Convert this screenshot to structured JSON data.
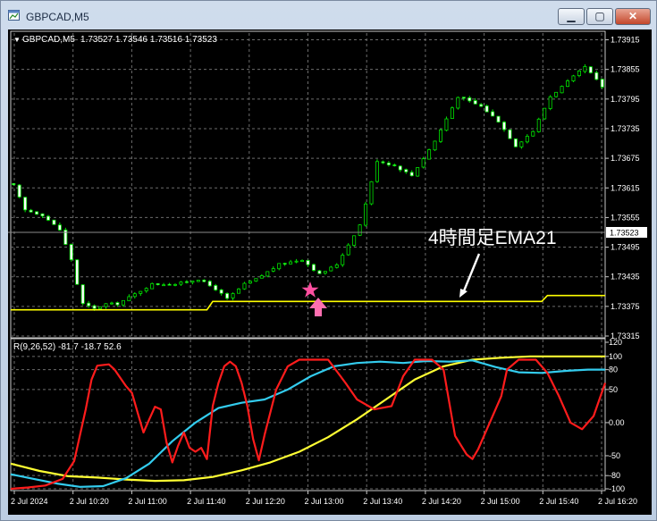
{
  "window": {
    "title": "GBPCAD,M5",
    "minimize_glyph": "▁",
    "maximize_glyph": "▢",
    "close_glyph": "✕",
    "app_icon": "chart-window-icon"
  },
  "main_chart": {
    "header": {
      "arrow": "▼",
      "symbol": "GBPCAD,M5",
      "ohlc": "1.73527 1.73546 1.73516 1.73523"
    },
    "price_labels": [
      "1.73915",
      "1.73855",
      "1.73795",
      "1.73735",
      "1.73675",
      "1.73615",
      "1.73555",
      "1.73495",
      "1.73435",
      "1.73375",
      "1.73315"
    ],
    "current_price": "1.73523",
    "annotation": "4時間足EMA21",
    "arrow_icon": "up-arrow-icon",
    "star_icon": "star-icon"
  },
  "indicator": {
    "header": "R(9,26,52) -81.7 -18.7 52.6",
    "levels": [
      "120",
      "100",
      "80",
      "50",
      "0.00",
      "-50",
      "-80",
      "-100"
    ]
  },
  "time_axis": [
    "2 Jul 2024",
    "2 Jul 10:20",
    "2 Jul 11:00",
    "2 Jul 11:40",
    "2 Jul 12:20",
    "2 Jul 13:00",
    "2 Jul 13:40",
    "2 Jul 14:20",
    "2 Jul 15:00",
    "2 Jul 15:40",
    "2 Jul 16:20"
  ],
  "colors": {
    "bull": "#00e400",
    "bear": "#ffffff",
    "ema": "#ffff00",
    "osc_fast": "#ff1c1c",
    "osc_mid": "#33ccee",
    "osc_slow": "#ffff33",
    "grid": "#6c6c6c",
    "arrow": "#ff6fb0"
  },
  "chart_data": {
    "type": "candlestick",
    "title": "GBPCAD,M5",
    "candle_count": 103,
    "ylim": [
      1.73315,
      1.73925
    ],
    "close_path": [
      [
        0,
        1.7362
      ],
      [
        2,
        1.7357
      ],
      [
        5,
        1.7356
      ],
      [
        8,
        1.7353
      ],
      [
        10,
        1.7347
      ],
      [
        11,
        1.7342
      ],
      [
        12,
        1.7338
      ],
      [
        14,
        1.7337
      ],
      [
        16,
        1.7338
      ],
      [
        18,
        1.7338
      ],
      [
        21,
        1.734
      ],
      [
        24,
        1.7342
      ],
      [
        28,
        1.7342
      ],
      [
        32,
        1.7343
      ],
      [
        35,
        1.7341
      ],
      [
        37,
        1.7339
      ],
      [
        40,
        1.7342
      ],
      [
        42,
        1.7343
      ],
      [
        46,
        1.7346
      ],
      [
        50,
        1.7347
      ],
      [
        53,
        1.7344
      ],
      [
        56,
        1.7346
      ],
      [
        60,
        1.7354
      ],
      [
        63,
        1.7367
      ],
      [
        66,
        1.7366
      ],
      [
        69,
        1.7364
      ],
      [
        73,
        1.7371
      ],
      [
        77,
        1.738
      ],
      [
        81,
        1.7378
      ],
      [
        84,
        1.7375
      ],
      [
        87,
        1.737
      ],
      [
        90,
        1.7373
      ],
      [
        93,
        1.738
      ],
      [
        96,
        1.7383
      ],
      [
        99,
        1.7386
      ],
      [
        102,
        1.7382
      ]
    ],
    "ema21_steps": [
      [
        0,
        1.73368
      ],
      [
        34,
        1.73368
      ],
      [
        35,
        1.73385
      ],
      [
        92,
        1.73385
      ],
      [
        93,
        1.73397
      ],
      [
        103,
        1.73397
      ]
    ],
    "indicator_ylim": [
      -100,
      120
    ],
    "series": [
      {
        "name": "R(9,26,52)",
        "points": [
          [
            0,
            -100
          ],
          [
            3,
            -98
          ],
          [
            6,
            -95
          ],
          [
            9,
            -85
          ],
          [
            11,
            -58
          ],
          [
            13,
            20
          ],
          [
            14,
            65
          ],
          [
            15,
            86
          ],
          [
            17,
            88
          ],
          [
            18,
            80
          ],
          [
            20,
            55
          ],
          [
            21,
            45
          ],
          [
            22,
            15
          ],
          [
            23,
            -15
          ],
          [
            24,
            5
          ],
          [
            25,
            24
          ],
          [
            26,
            20
          ],
          [
            27,
            -30
          ],
          [
            28,
            -60
          ],
          [
            29,
            -35
          ],
          [
            30,
            -15
          ],
          [
            31,
            -38
          ],
          [
            32,
            -44
          ],
          [
            33,
            -38
          ],
          [
            34,
            -55
          ],
          [
            35,
            25
          ],
          [
            36,
            60
          ],
          [
            37,
            85
          ],
          [
            38,
            92
          ],
          [
            39,
            85
          ],
          [
            40,
            60
          ],
          [
            41,
            25
          ],
          [
            42,
            -25
          ],
          [
            43,
            -57
          ],
          [
            44,
            -18
          ],
          [
            46,
            50
          ],
          [
            48,
            85
          ],
          [
            50,
            95
          ],
          [
            55,
            95
          ],
          [
            58,
            60
          ],
          [
            60,
            35
          ],
          [
            63,
            20
          ],
          [
            66,
            25
          ],
          [
            68,
            70
          ],
          [
            70,
            95
          ],
          [
            73,
            95
          ],
          [
            75,
            80
          ],
          [
            77,
            -20
          ],
          [
            79,
            -48
          ],
          [
            80,
            -55
          ],
          [
            81,
            -40
          ],
          [
            83,
            0
          ],
          [
            85,
            40
          ],
          [
            86,
            80
          ],
          [
            88,
            95
          ],
          [
            91,
            95
          ],
          [
            93,
            75
          ],
          [
            95,
            40
          ],
          [
            97,
            0
          ],
          [
            99,
            -10
          ],
          [
            101,
            10
          ],
          [
            103,
            60
          ]
        ]
      },
      {
        "name": "R(9,26,52) mid",
        "points": [
          [
            0,
            -78
          ],
          [
            4,
            -85
          ],
          [
            8,
            -92
          ],
          [
            12,
            -97
          ],
          [
            16,
            -96
          ],
          [
            20,
            -84
          ],
          [
            24,
            -62
          ],
          [
            28,
            -28
          ],
          [
            32,
            0
          ],
          [
            36,
            22
          ],
          [
            40,
            30
          ],
          [
            44,
            35
          ],
          [
            48,
            50
          ],
          [
            52,
            70
          ],
          [
            56,
            85
          ],
          [
            60,
            90
          ],
          [
            64,
            92
          ],
          [
            68,
            90
          ],
          [
            72,
            93
          ],
          [
            76,
            92
          ],
          [
            80,
            94
          ],
          [
            84,
            84
          ],
          [
            88,
            76
          ],
          [
            92,
            75
          ],
          [
            96,
            78
          ],
          [
            100,
            80
          ],
          [
            103,
            80
          ]
        ]
      },
      {
        "name": "R(9,26,52) slow",
        "points": [
          [
            0,
            -62
          ],
          [
            5,
            -73
          ],
          [
            10,
            -81
          ],
          [
            15,
            -83
          ],
          [
            20,
            -86
          ],
          [
            25,
            -88
          ],
          [
            30,
            -87
          ],
          [
            35,
            -82
          ],
          [
            40,
            -72
          ],
          [
            45,
            -60
          ],
          [
            50,
            -44
          ],
          [
            55,
            -22
          ],
          [
            60,
            5
          ],
          [
            65,
            35
          ],
          [
            70,
            65
          ],
          [
            75,
            85
          ],
          [
            80,
            95
          ],
          [
            85,
            98
          ],
          [
            90,
            100
          ],
          [
            95,
            100
          ],
          [
            100,
            100
          ],
          [
            103,
            100
          ]
        ]
      }
    ]
  }
}
